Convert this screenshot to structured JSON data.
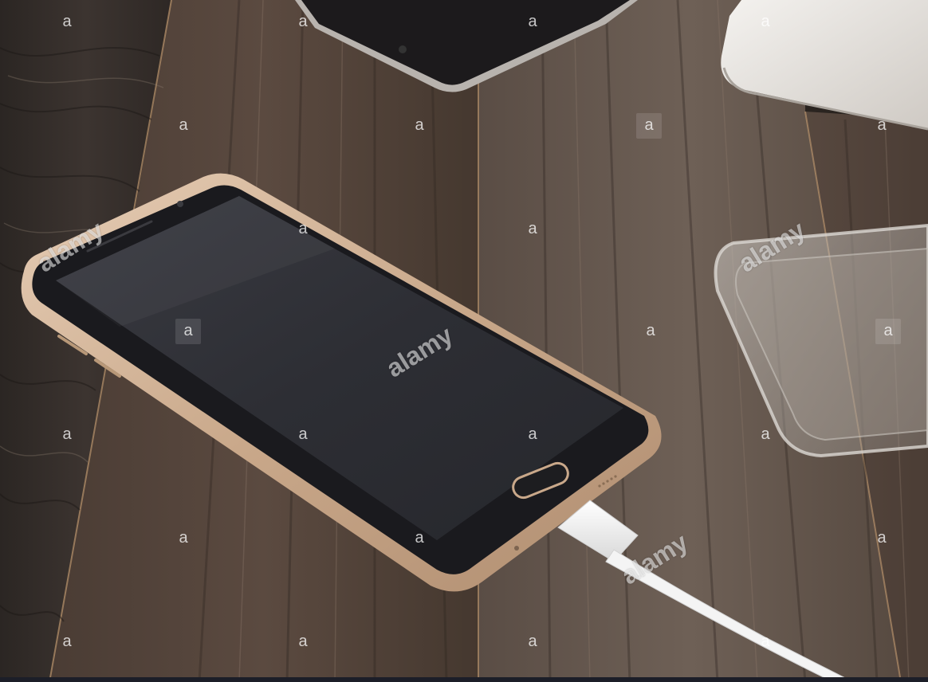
{
  "watermark": {
    "brand_word": "alamy",
    "badge_letter": "a"
  },
  "scene": {
    "subject": "smartphone-charging-on-wooden-table",
    "colors": {
      "wood_dark": "#2a2420",
      "wood_mid": "#4a3f38",
      "wood_light": "#6b5d52",
      "gold_frame": "#c9a88a",
      "screen": "#2e2e34",
      "cable": "#f2f2f2",
      "clear_case": "#b7b3ae"
    }
  }
}
